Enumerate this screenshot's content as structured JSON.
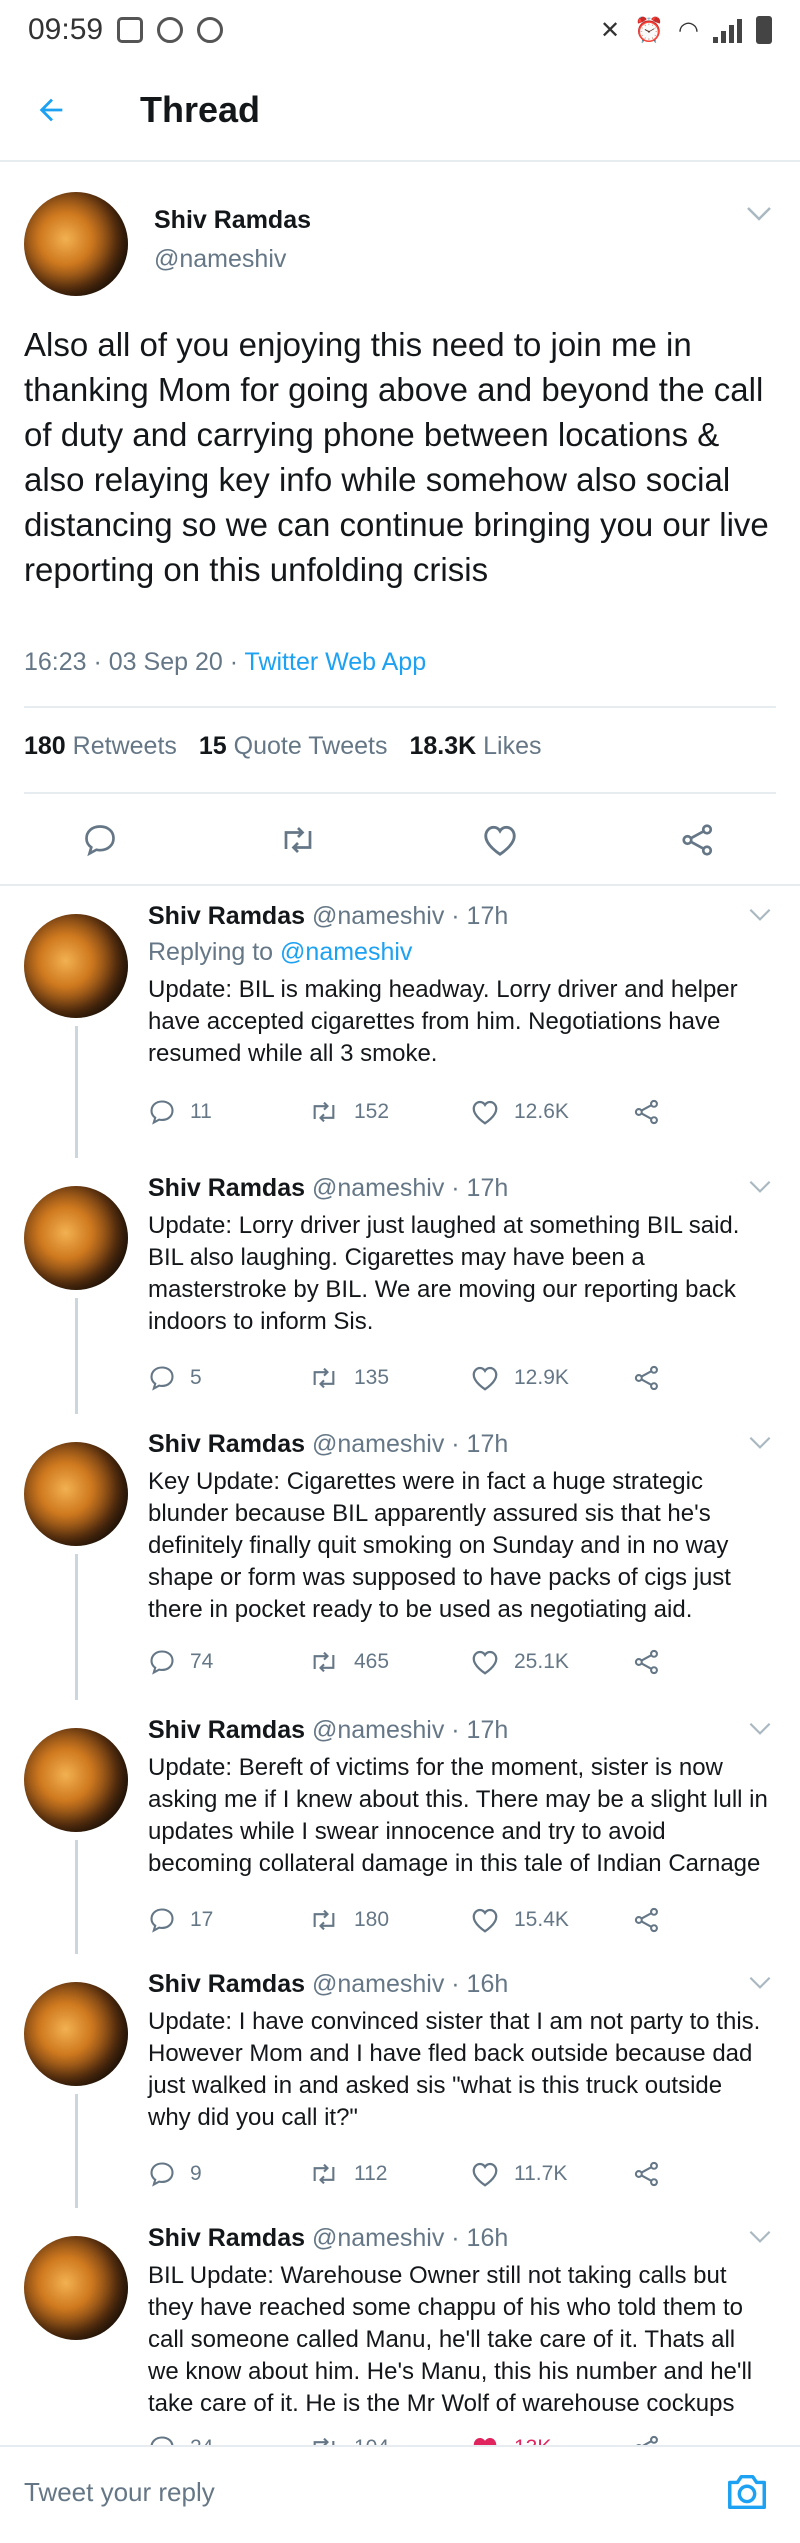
{
  "status_bar": {
    "time": "09:59"
  },
  "header": {
    "title": "Thread"
  },
  "main_tweet": {
    "name": "Shiv Ramdas",
    "handle": "@nameshiv",
    "text": "Also all of you enjoying this need to join me in thanking Mom for going above and beyond the call of duty and carrying phone between locations & also relaying key info while somehow also social distancing so we can continue bringing you our live reporting on this unfolding crisis",
    "time": "16:23 · 03 Sep 20 · ",
    "app": "Twitter Web App",
    "retweets_count": "180",
    "retweets_label": "Retweets",
    "quotes_count": "15",
    "quotes_label": "Quote Tweets",
    "likes_count": "18.3K",
    "likes_label": "Likes"
  },
  "replies": [
    {
      "name": "Shiv Ramdas",
      "handle": "@nameshiv · 17h",
      "replying_prefix": "Replying to ",
      "replying_to": "@nameshiv",
      "text": "Update: BIL is making headway. Lorry driver and helper have accepted cigarettes from him. Negotiations have resumed while all 3 smoke.",
      "replies": "11",
      "retweets": "152",
      "likes": "12.6K"
    },
    {
      "name": "Shiv Ramdas",
      "handle": "@nameshiv · 17h",
      "text": "Update: Lorry driver just laughed at something BIL said. BIL also laughing. Cigarettes may have been a masterstroke by BIL. We are moving our reporting back indoors to inform Sis.",
      "replies": "5",
      "retweets": "135",
      "likes": "12.9K"
    },
    {
      "name": "Shiv Ramdas",
      "handle": "@nameshiv · 17h",
      "text": "Key Update: Cigarettes were in fact a huge strategic blunder because BIL apparently assured sis that he's definitely finally quit smoking on Sunday and in no way shape or form was supposed to have packs of cigs just there in pocket ready to be used as negotiating aid.",
      "replies": "74",
      "retweets": "465",
      "likes": "25.1K"
    },
    {
      "name": "Shiv Ramdas",
      "handle": "@nameshiv · 17h",
      "text": "Update: Bereft of victims for the moment, sister is now asking me if I knew about this. There may be a slight lull in updates while I swear innocence and try to avoid becoming collateral damage in this tale of Indian Carnage",
      "replies": "17",
      "retweets": "180",
      "likes": "15.4K"
    },
    {
      "name": "Shiv Ramdas",
      "handle": "@nameshiv · 16h",
      "text": "Update: I have convinced sister that I am not party to this. However Mom and I have fled back outside because dad just walked in and asked sis \"what is this truck outside why did you call it?\"",
      "replies": "9",
      "retweets": "112",
      "likes": "11.7K"
    },
    {
      "name": "Shiv Ramdas",
      "handle": "@nameshiv · 16h",
      "text": "BIL Update: Warehouse Owner still not taking calls but they have reached some chappu of his who told them to call someone called Manu, he'll take care of it. Thats all we know about him. He's Manu, this his number and he'll take care of it.  He is the Mr Wolf of warehouse cockups",
      "replies": "24",
      "retweets": "104",
      "likes": "13K"
    }
  ],
  "compose": {
    "placeholder": "Tweet your reply"
  },
  "colors": {
    "accent": "#1da1f2",
    "like": "#e0245e",
    "muted": "#657786"
  }
}
